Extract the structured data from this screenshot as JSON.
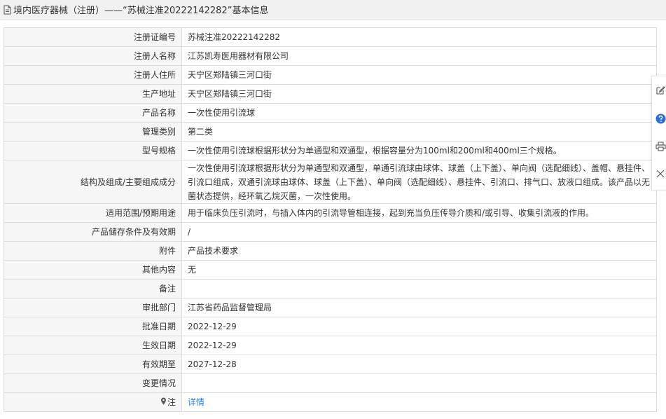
{
  "header": {
    "title": "境内医疗器械（注册）——“苏械注准20222142282”基本信息"
  },
  "rows": [
    {
      "label": "注册证编号",
      "value": "苏械注准20222142282"
    },
    {
      "label": "注册人名称",
      "value": "江苏凯寿医用器材有限公司"
    },
    {
      "label": "注册人住所",
      "value": "天宁区郑陆镇三河口街"
    },
    {
      "label": "生产地址",
      "value": "天宁区郑陆镇三河口街"
    },
    {
      "label": "产品名称",
      "value": "一次性使用引流球"
    },
    {
      "label": "管理类别",
      "value": "第二类"
    },
    {
      "label": "型号规格",
      "value": "一次性使用引流球根据形状分为单通型和双通型，根据容量分为100ml和200ml和400ml三个规格。"
    },
    {
      "label": "结构及组成/主要组成成分",
      "value": "一次性使用引流球根据形状分为单通型和双通型，单通引流球由球体、球盖（上下盖）、单向阀（选配细线）、盖帽、悬挂件、引流口组成，双通引流球由球体、球盖（上下盖）、单向阀（选配细线）、悬挂件、引流口、排气口、放液口组成。该产品以无菌状态提供，经环氧乙烷灭菌，一次性使用。"
    },
    {
      "label": "适用范围/预期用途",
      "value": "用于临床负压引流时，与插入体内的引流导管相连接，起到充当负压传导介质和/或引导、收集引流液的作用。"
    },
    {
      "label": "产品储存条件及有效期",
      "value": "/"
    },
    {
      "label": "附件",
      "value": "产品技术要求"
    },
    {
      "label": "其他内容",
      "value": "无"
    },
    {
      "label": "备注",
      "value": ""
    },
    {
      "label": "审批部门",
      "value": "江苏省药品监督管理局"
    },
    {
      "label": "批准日期",
      "value": "2022-12-29"
    },
    {
      "label": "生效日期",
      "value": "2022-12-29"
    },
    {
      "label": "有效期至",
      "value": "2027-12-28"
    },
    {
      "label": "变更情况",
      "value": ""
    },
    {
      "label": "注",
      "value": "详情"
    }
  ],
  "sidebar": {
    "icons": [
      "edit-icon",
      "help-icon",
      "print-icon",
      "close-icon"
    ]
  },
  "colors": {
    "link": "#2d7bd6",
    "label_bg": "#f6f6f6",
    "border": "#dcdcdc",
    "help_icon": "#2d6fd4"
  }
}
